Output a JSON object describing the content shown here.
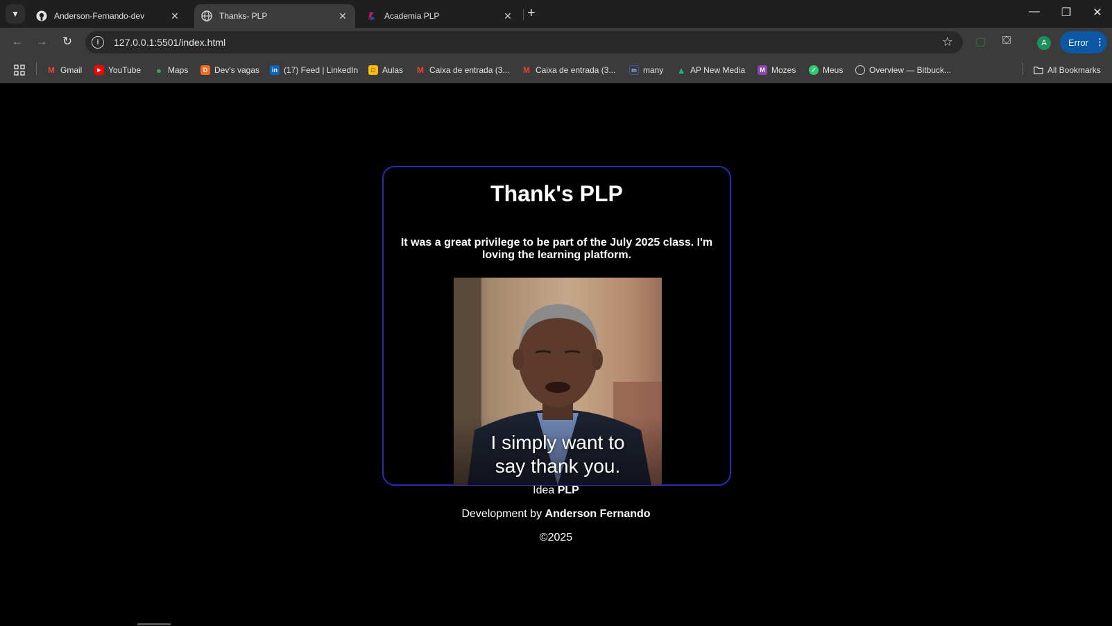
{
  "tabs": [
    {
      "label": "Anderson-Fernando-dev",
      "active": false
    },
    {
      "label": "Thanks- PLP",
      "active": true
    },
    {
      "label": "Academia PLP",
      "active": false
    }
  ],
  "toolbar": {
    "url": "127.0.0.1:5501/index.html",
    "error_label": "Error",
    "avatar_letter": "A"
  },
  "bookmarks": [
    {
      "label": "Gmail",
      "icon": "gmail-icon",
      "color": "#ea4335"
    },
    {
      "label": "YouTube",
      "icon": "youtube-icon",
      "color": "#ff0000"
    },
    {
      "label": "Maps",
      "icon": "maps-icon",
      "color": "#34a853"
    },
    {
      "label": "Dev's vagas",
      "icon": "devs-vagas-icon",
      "color": "#f26b21"
    },
    {
      "label": "(17) Feed | LinkedIn",
      "icon": "linkedin-icon",
      "color": "#0a66c2"
    },
    {
      "label": "Aulas",
      "icon": "aulas-icon",
      "color": "#fbbc04"
    },
    {
      "label": "Caixa de entrada (3...",
      "icon": "gmail-icon",
      "color": "#ea4335"
    },
    {
      "label": "Caixa de entrada (3...",
      "icon": "gmail-icon",
      "color": "#ea4335"
    },
    {
      "label": "many",
      "icon": "many-icon",
      "color": "#3f51b5"
    },
    {
      "label": "AP New Media",
      "icon": "ap-new-media-icon",
      "color": "#1db97a"
    },
    {
      "label": "Mozes",
      "icon": "mozes-icon",
      "color": "#8e44ad"
    },
    {
      "label": "Meus",
      "icon": "meus-icon",
      "color": "#2ecc71"
    },
    {
      "label": "Overview — Bitbuck...",
      "icon": "globe-icon",
      "color": "#9aa0a6"
    }
  ],
  "all_bookmarks_label": "All Bookmarks",
  "page": {
    "title": "Thank's PLP",
    "message": "It was a great privilege to be part of the July 2025 class. I'm loving the learning platform.",
    "gif_caption_line1": "I simply want to",
    "gif_caption_line2": "say thank you.",
    "idea_prefix": "Idea",
    "idea_name": "PLP",
    "dev_prefix": "Development by",
    "dev_name": "Anderson Fernando",
    "copyright": "©2025"
  }
}
